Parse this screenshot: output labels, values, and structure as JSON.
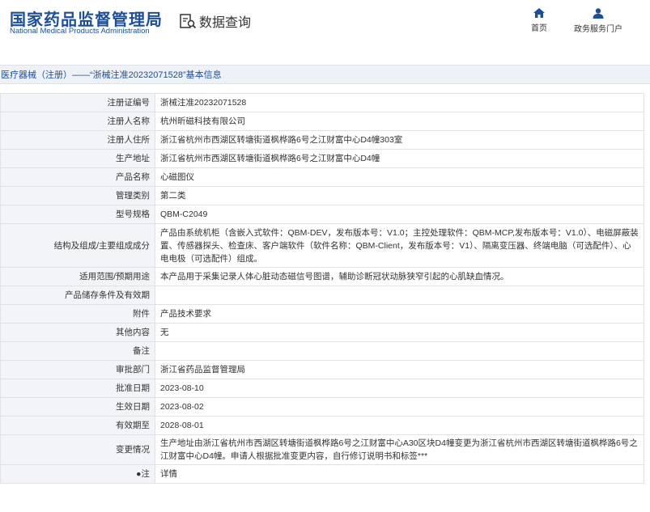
{
  "header": {
    "logo_cn": "国家药品监督管理局",
    "logo_en": "National Medical Products Administration",
    "search_title": "数据查询",
    "nav": [
      {
        "label": "首页",
        "icon": "home-icon"
      },
      {
        "label": "政务服务门户",
        "icon": "user-icon"
      }
    ]
  },
  "title_bar": "医疗器械（注册）——“浙械注准20232071528”基本信息",
  "rows": [
    {
      "key": "注册证编号",
      "value": "浙械注准20232071528"
    },
    {
      "key": "注册人名称",
      "value": "杭州昕磁科技有限公司"
    },
    {
      "key": "注册人住所",
      "value": "浙江省杭州市西湖区转塘街道枫桦路6号之江财富中心D4幢303室"
    },
    {
      "key": "生产地址",
      "value": "浙江省杭州市西湖区转塘街道枫桦路6号之江财富中心D4幢"
    },
    {
      "key": "产品名称",
      "value": "心磁图仪"
    },
    {
      "key": "管理类别",
      "value": "第二类"
    },
    {
      "key": "型号规格",
      "value": "QBM-C2049"
    },
    {
      "key": "结构及组成/主要组成成分",
      "value": "产品由系统机柜（含嵌入式软件：QBM-DEV，发布版本号：V1.0；主控处理软件：QBM-MCP,发布版本号：V1.0）、电磁屏蔽装置、传感器探头、检查床、客户端软件（软件名称：QBM-Client，发布版本号：V1）、隔离变压器、终端电脑（可选配件）、心电电极（可选配件）组成。"
    },
    {
      "key": "适用范围/预期用途",
      "value": "本产品用于采集记录人体心脏动态磁信号图谱，辅助诊断冠状动脉狭窄引起的心肌缺血情况。"
    },
    {
      "key": "产品储存条件及有效期",
      "value": ""
    },
    {
      "key": "附件",
      "value": "产品技术要求"
    },
    {
      "key": "其他内容",
      "value": "无"
    },
    {
      "key": "备注",
      "value": ""
    },
    {
      "key": "审批部门",
      "value": "浙江省药品监督管理局"
    },
    {
      "key": "批准日期",
      "value": "2023-08-10"
    },
    {
      "key": "生效日期",
      "value": "2023-08-02"
    },
    {
      "key": "有效期至",
      "value": "2028-08-01"
    },
    {
      "key": "变更情况",
      "value": "生产地址由浙江省杭州市西湖区转塘街道枫桦路6号之江财富中心A30区块D4幢变更为浙江省杭州市西湖区转塘街道枫桦路6号之江财富中心D4幢。申请人根据批准变更内容，自行修订说明书和标签***"
    },
    {
      "key": "●注",
      "value": "详情"
    }
  ]
}
